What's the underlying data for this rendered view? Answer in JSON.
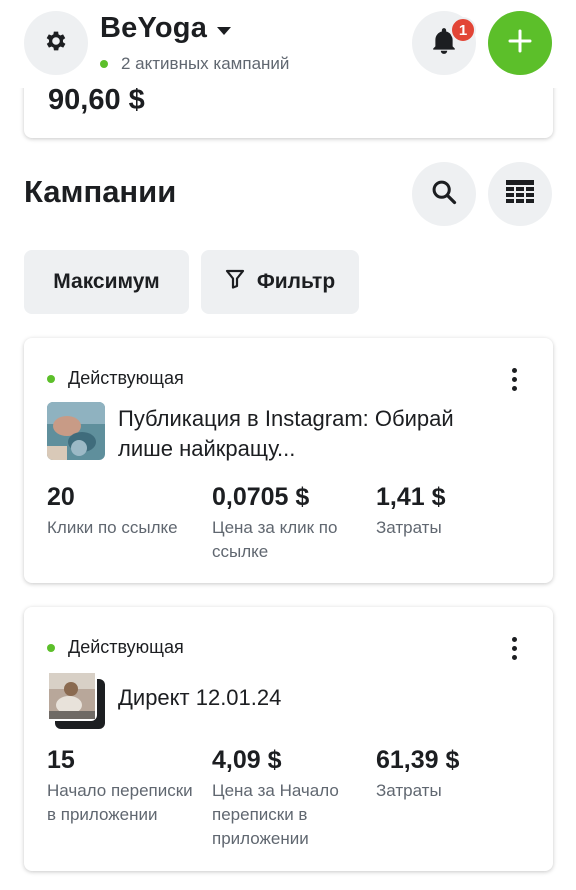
{
  "header": {
    "account_name": "BeYoga",
    "active_campaigns": "2 активных кампаний",
    "notification_count": "1",
    "icons": {
      "settings": "gear-icon",
      "notifications": "bell-icon",
      "add": "plus-icon",
      "dropdown": "caret-down-icon"
    }
  },
  "summary": {
    "amount": "90,60 $"
  },
  "campaigns_section": {
    "title": "Кампании",
    "icons": {
      "search": "search-icon",
      "table": "table-icon",
      "filter": "filter-icon"
    },
    "chips": {
      "sort_label": "Максимум",
      "filter_label": "Фильтр"
    }
  },
  "campaigns": [
    {
      "status": "Действующая",
      "title": "Публикация в Instagram: Обирай лише найкращу...",
      "metrics": [
        {
          "value": "20",
          "label": "Клики по ссылке"
        },
        {
          "value": "0,0705 $",
          "label": "Цена за клик по ссылке"
        },
        {
          "value": "1,41 $",
          "label": "Затраты"
        }
      ]
    },
    {
      "status": "Действующая",
      "title": "Директ 12.01.24",
      "metrics": [
        {
          "value": "15",
          "label": "Начало переписки в приложении"
        },
        {
          "value": "4,09 $",
          "label": "Цена за Начало переписки в приложении"
        },
        {
          "value": "61,39 $",
          "label": "Затраты"
        }
      ]
    }
  ],
  "colors": {
    "accent_green": "#5cbf2a",
    "badge_red": "#e24536",
    "button_gray": "#eef0f2"
  }
}
